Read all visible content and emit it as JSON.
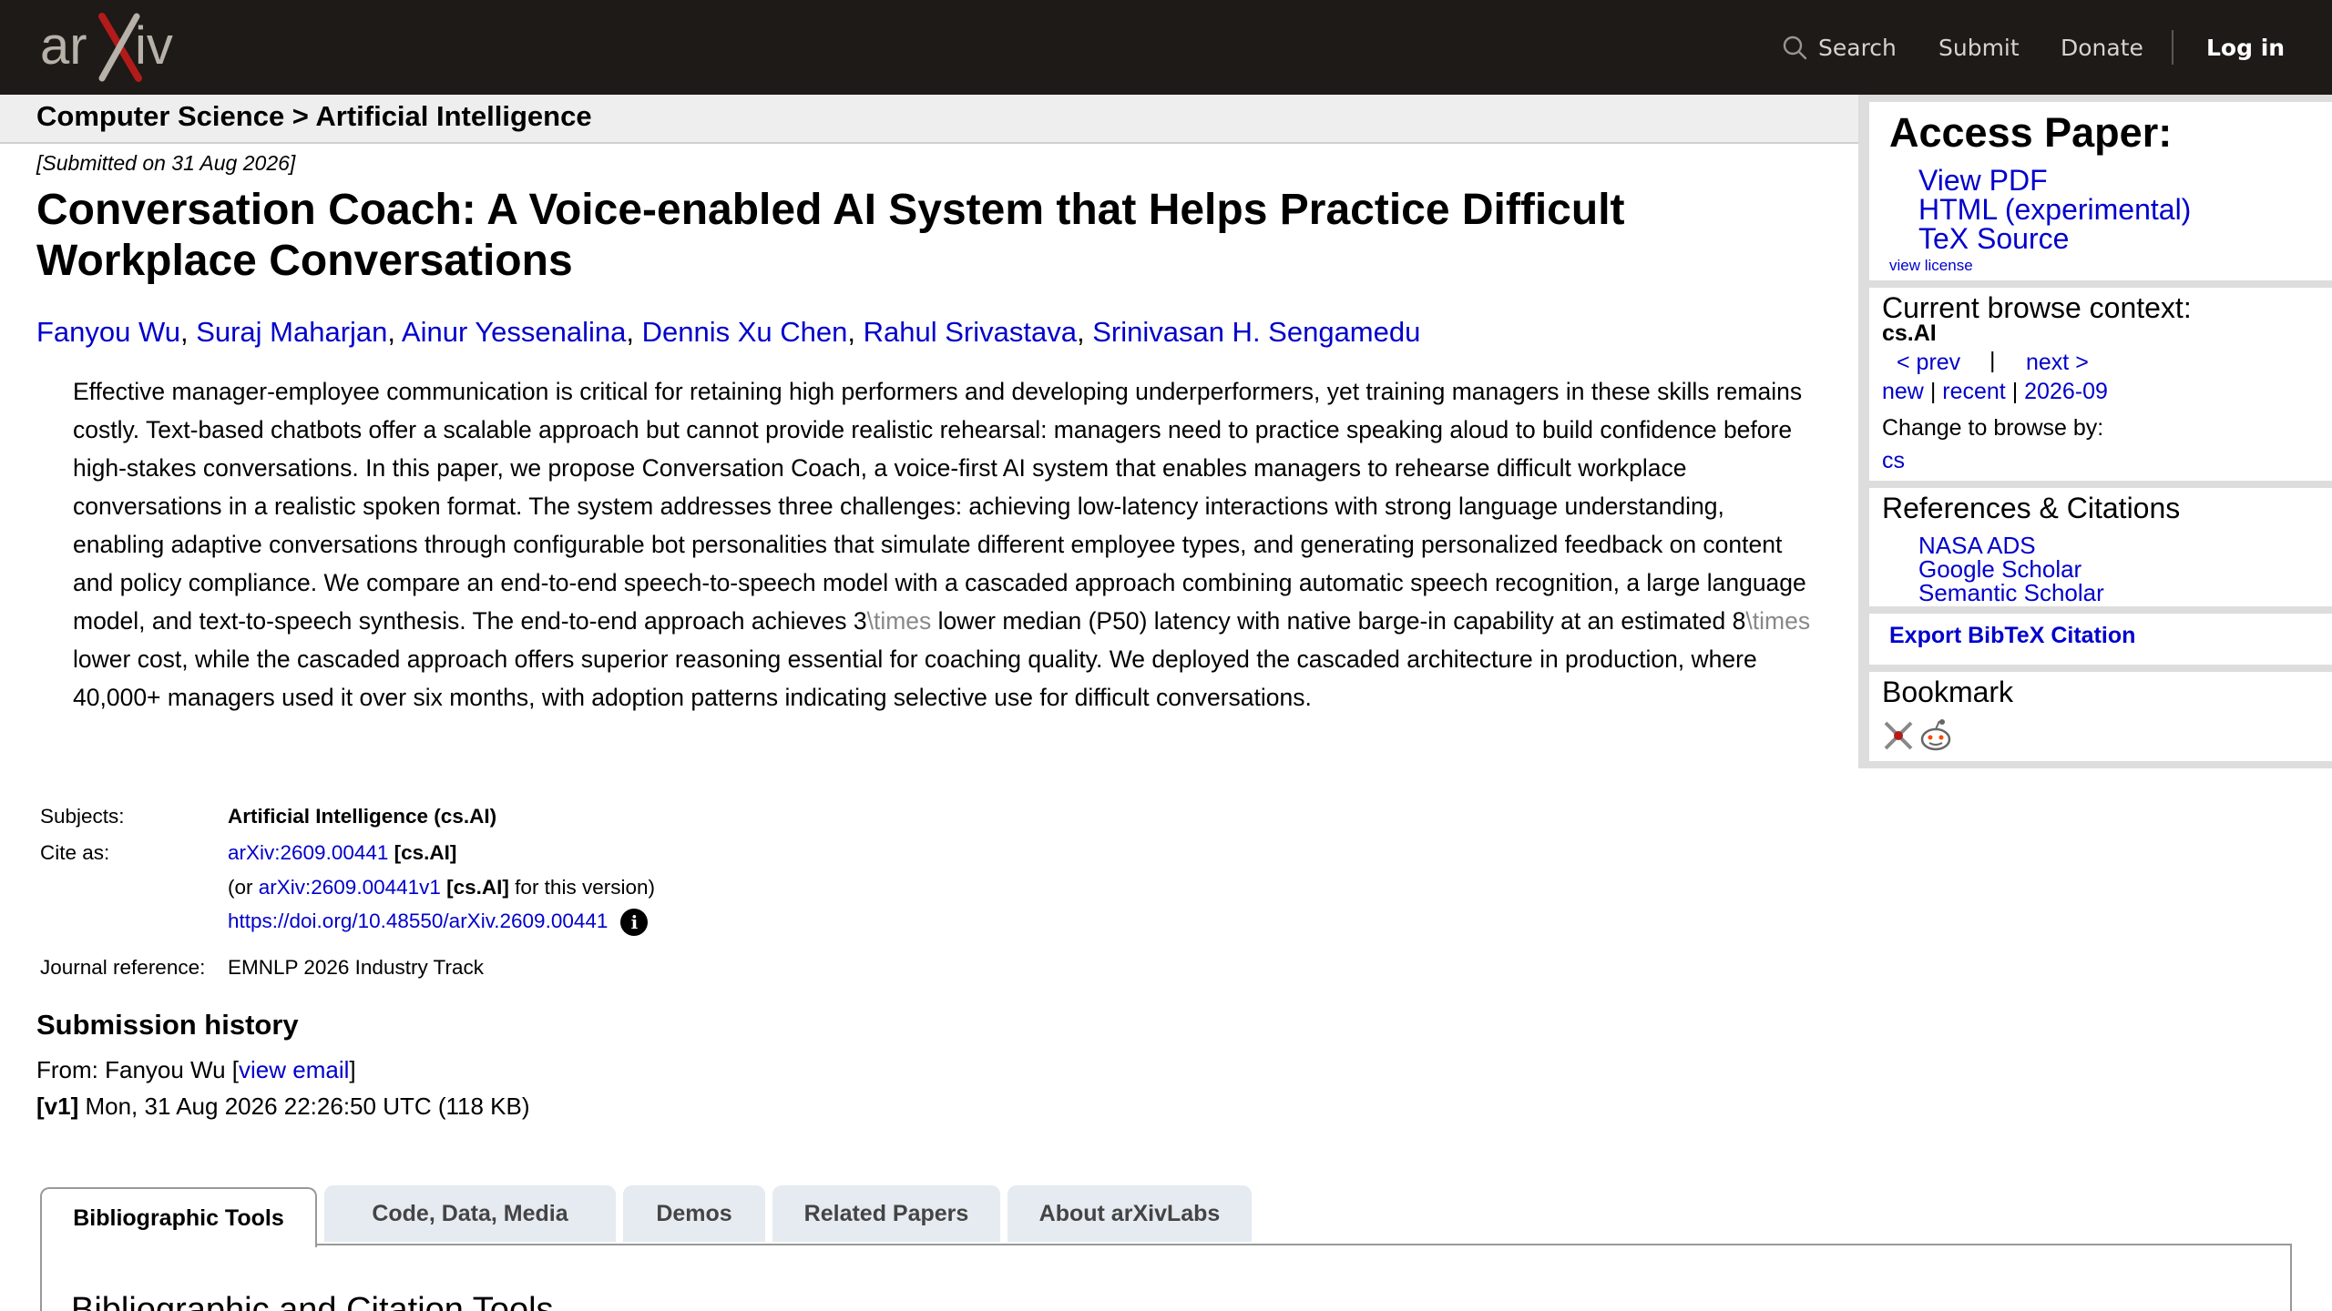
{
  "header": {
    "logo_text": "arXiv",
    "nav": {
      "search": "Search",
      "submit": "Submit",
      "donate": "Donate",
      "login": "Log in"
    }
  },
  "breadcrumb": "Computer Science > Artificial Intelligence",
  "paper": {
    "submitted": "[Submitted on 31 Aug 2026]",
    "title": "Conversation Coach: A Voice-enabled AI System that Helps Practice Difficult Workplace Conversations",
    "authors": [
      "Fanyou Wu",
      "Suraj Maharjan",
      "Ainur Yessenalina",
      "Dennis Xu Chen",
      "Rahul Srivastava",
      "Srinivasan H. Sengamedu"
    ],
    "abstract": {
      "part1": "Effective manager-employee communication is critical for retaining high performers and developing underperformers, yet training managers in these skills remains costly. Text-based chatbots offer a scalable approach but cannot provide realistic rehearsal: managers need to practice speaking aloud to build confidence before high-stakes conversations. In this paper, we propose Conversation Coach, a voice-first AI system that enables managers to rehearse difficult workplace conversations in a realistic spoken format. The system addresses three challenges: achieving low-latency interactions with strong language understanding, enabling adaptive conversations through configurable bot personalities that simulate different employee types, and generating personalized feedback on content and policy compliance. We compare an end-to-end speech-to-speech model with a cascaded approach combining automatic speech recognition, a large language model, and text-to-speech synthesis. The end-to-end approach achieves 3",
      "tex1": "\\times",
      "part2": " lower median (P50) latency with native barge-in capability at an estimated 8",
      "tex2": "\\times",
      "part3": " lower cost, while the cascaded approach offers superior reasoning essential for coaching quality. We deployed the cascaded architecture in production, where 40,000+ managers used it over six months, with adoption patterns indicating selective use for difficult conversations."
    }
  },
  "metadata": {
    "subjects_label": "Subjects:",
    "subjects_value": "Artificial Intelligence (cs.AI)",
    "cite_label": "Cite as:",
    "cite_id": "arXiv:2609.00441",
    "cite_cat": " [cs.AI]",
    "cite_version_prefix": "(or ",
    "cite_version_id": "arXiv:2609.00441v1",
    "cite_version_cat": " [cs.AI]",
    "cite_version_suffix": " for this version)",
    "doi": "https://doi.org/10.48550/arXiv.2609.00441",
    "journal_label": "Journal reference:",
    "journal_value": "EMNLP 2026 Industry Track"
  },
  "submission_history": {
    "heading": "Submission history",
    "from_prefix": "From: Fanyou Wu [",
    "view_email": "view email",
    "from_suffix": "]",
    "v1_label": "[v1]",
    "v1_value": " Mon, 31 Aug 2026 22:26:50 UTC (118 KB)"
  },
  "tabs": [
    "Bibliographic Tools",
    "Code, Data, Media",
    "Demos",
    "Related Papers",
    "About arXivLabs"
  ],
  "tab_panel_heading": "Bibliographic and Citation Tools",
  "sidebar": {
    "access_heading": "Access Paper:",
    "access_links": [
      "View PDF",
      "HTML (experimental)",
      "TeX Source"
    ],
    "view_license": "view license",
    "context_heading": "Current browse context:",
    "context_value": "cs.AI",
    "prev": "< prev",
    "pipe": "|",
    "next": "next >",
    "new": "new",
    "recent": "recent",
    "month": "2026-09",
    "change_browse": "Change to browse by:",
    "browse_cs": "cs",
    "refs_heading": "References & Citations",
    "refs_links": [
      "NASA ADS",
      "Google Scholar",
      "Semantic Scholar"
    ],
    "bibtex": "Export BibTeX Citation",
    "bookmark_heading": "Bookmark"
  }
}
